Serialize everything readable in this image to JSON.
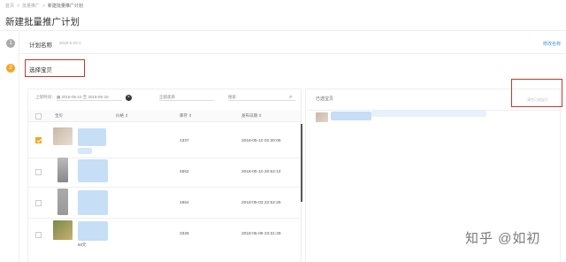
{
  "breadcrumb": {
    "items": [
      "首页",
      "批量推广",
      "新建批量推广计划"
    ]
  },
  "page_title": "新建批量推广计划",
  "steps": [
    {
      "number": "1",
      "label": "计划名称",
      "date": "2018-5-10-1",
      "action": "修改名称"
    },
    {
      "number": "2",
      "label": "选择宝贝"
    }
  ],
  "filters": {
    "launch_time_label": "上架时间：",
    "date_range": "2018-05-10 至 2018-05-15",
    "category_placeholder": "全部类目",
    "search_placeholder": "搜索"
  },
  "table": {
    "headers": [
      "宝贝",
      "价格",
      "库存",
      "发布日期"
    ],
    "rows": [
      {
        "checked": true,
        "stock": "1337",
        "date": "2018-05-10 02:30:05",
        "price": ""
      },
      {
        "checked": false,
        "stock": "4662",
        "date": "2018-05-10 20:52:14",
        "price": ""
      },
      {
        "checked": false,
        "stock": "1864",
        "date": "2018-05-03 22:52:25",
        "price": ""
      },
      {
        "checked": false,
        "stock": "3328",
        "date": "2018-05-08 23:31:29",
        "price": "60元"
      }
    ]
  },
  "right_panel": {
    "title": "已选宝贝",
    "clear_link": "清空已选宝贝"
  },
  "watermark": "知乎 @如初",
  "colors": {
    "accent": "#f5a623",
    "highlight_border": "#c0392b",
    "link": "#3b8fe8",
    "blur": "#bcd8f5"
  }
}
